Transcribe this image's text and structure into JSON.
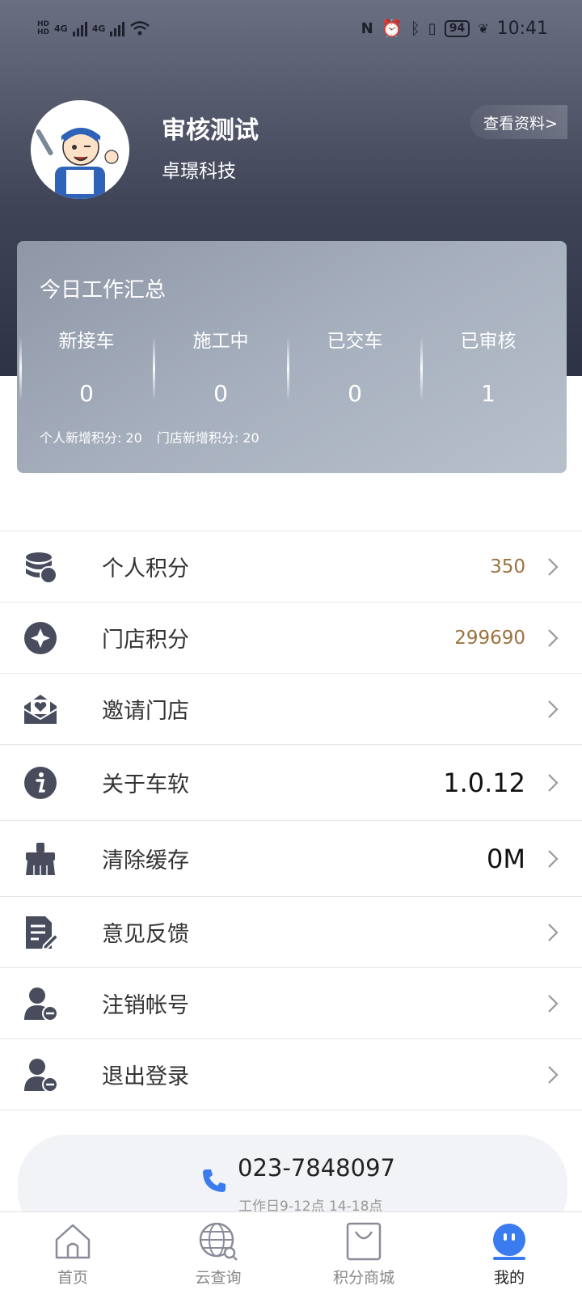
{
  "status_bar": {
    "network_left": "4G",
    "network_right": "4G",
    "battery": "94",
    "time": "10:41"
  },
  "profile": {
    "name": "审核测试",
    "company": "卓璟科技",
    "view_profile": "查看资料>"
  },
  "summary": {
    "title": "今日工作汇总",
    "stats": [
      {
        "label": "新接车",
        "value": "0"
      },
      {
        "label": "施工中",
        "value": "0"
      },
      {
        "label": "已交车",
        "value": "0"
      },
      {
        "label": "已审核",
        "value": "1"
      }
    ],
    "personal_points": "个人新增积分: 20",
    "store_points": "门店新增积分: 20"
  },
  "menu": [
    {
      "label": "个人积分",
      "value": "350",
      "icon": "coins-icon"
    },
    {
      "label": "门店积分",
      "value": "299690",
      "icon": "diamond-icon"
    },
    {
      "label": "邀请门店",
      "value": "",
      "icon": "mail-heart-icon"
    },
    {
      "label": "关于车软",
      "value": "1.0.12",
      "icon": "info-icon"
    },
    {
      "label": "清除缓存",
      "value": "0M",
      "icon": "broom-icon"
    },
    {
      "label": "意见反馈",
      "value": "",
      "icon": "feedback-icon"
    },
    {
      "label": "注销帐号",
      "value": "",
      "icon": "user-remove-icon"
    },
    {
      "label": "退出登录",
      "value": "",
      "icon": "user-logout-icon"
    }
  ],
  "contact": {
    "phone": "023-7848097",
    "hours": "工作日9-12点 14-18点"
  },
  "tabs": [
    {
      "label": "首页",
      "icon": "home-icon"
    },
    {
      "label": "云查询",
      "icon": "globe-search-icon"
    },
    {
      "label": "积分商城",
      "icon": "shopping-bag-icon"
    },
    {
      "label": "我的",
      "icon": "profile-face-icon",
      "active": true
    }
  ],
  "colors": {
    "accent": "#3a7bf0",
    "points": "#9b7340",
    "header_dark": "#2d3244",
    "icon": "#484c5c"
  }
}
